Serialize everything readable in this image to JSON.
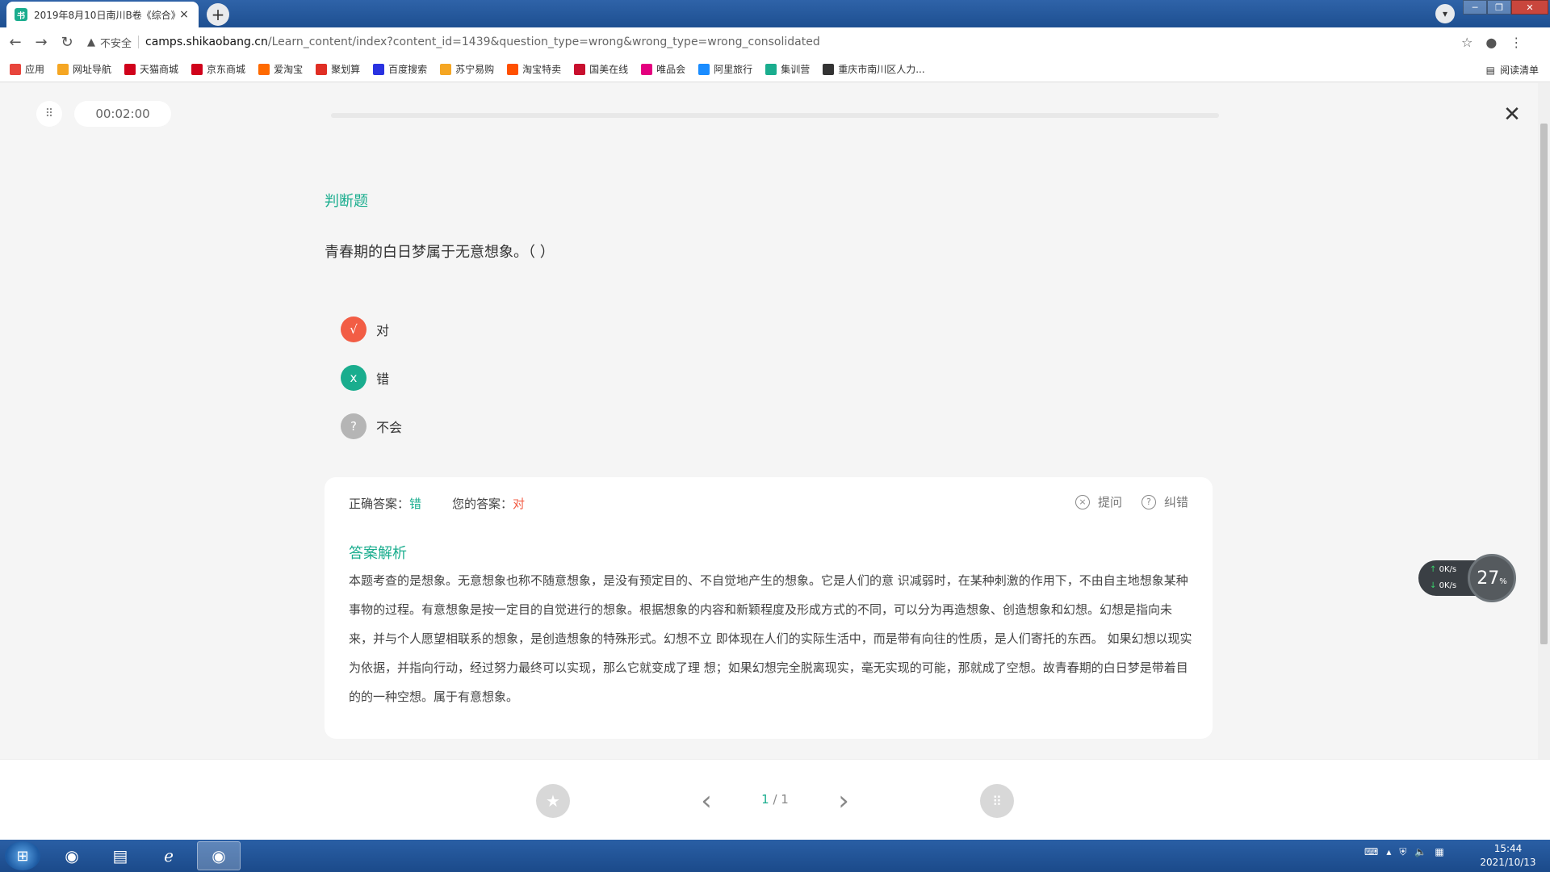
{
  "browser": {
    "tab_title": "2019年8月10日南川B卷《综合》",
    "tab_close": "×",
    "new_tab": "+",
    "insecure_label": "不安全",
    "url_host": "camps.shikaobang.cn",
    "url_path": "/Learn_content/index?content_id=1439&question_type=wrong&wrong_type=wrong_consolidated",
    "bookmarks": [
      {
        "label": "应用",
        "color": "#e8453c"
      },
      {
        "label": "网址导航",
        "color": "#f5a623"
      },
      {
        "label": "天猫商城",
        "color": "#d0021b"
      },
      {
        "label": "京东商城",
        "color": "#d0021b"
      },
      {
        "label": "爱淘宝",
        "color": "#ff6a00"
      },
      {
        "label": "聚划算",
        "color": "#e02e24"
      },
      {
        "label": "百度搜索",
        "color": "#2932e1"
      },
      {
        "label": "苏宁易购",
        "color": "#f5a623"
      },
      {
        "label": "淘宝特卖",
        "color": "#ff5000"
      },
      {
        "label": "国美在线",
        "color": "#c8102e"
      },
      {
        "label": "唯品会",
        "color": "#e4007f"
      },
      {
        "label": "阿里旅行",
        "color": "#1a8cff"
      },
      {
        "label": "集训营",
        "color": "#1aad8e"
      },
      {
        "label": "重庆市南川区人力...",
        "color": "#333333"
      }
    ],
    "reading_list": "阅读清单"
  },
  "quiz": {
    "timer": "00:02:00",
    "progress_fraction": 0.0,
    "question_type": "判断题",
    "question_text": "青春期的白日梦属于无意想象。（ ）",
    "options": [
      {
        "badge": "√",
        "label": "对",
        "color": "#f25d45"
      },
      {
        "badge": "x",
        "label": "错",
        "color": "#1aad8e"
      },
      {
        "badge": "?",
        "label": "不会",
        "color": "#b5b5b5"
      }
    ],
    "answer": {
      "correct_label": "正确答案：",
      "correct_value": "错",
      "yours_label": "您的答案：",
      "yours_value": "对",
      "ask_label": "提问",
      "report_label": "纠错"
    },
    "analysis_title": "答案解析",
    "analysis_text": "本题考查的是想象。无意想象也称不随意想象，是没有预定目的、不自觉地产生的想象。它是人们的意 识减弱时，在某种刺激的作用下，不由自主地想象某种事物的过程。有意想象是按一定目的自觉进行的想象。根据想象的内容和新颖程度及形成方式的不同，可以分为再造想象、创造想象和幻想。幻想是指向未来，并与个人愿望相联系的想象，是创造想象的特殊形式。幻想不立 即体现在人们的实际生活中，而是带有向往的性质，是人们寄托的东西。 如果幻想以现实为依据，并指向行动，经过努力最终可以实现，那么它就变成了理 想；如果幻想完全脱离现实，毫无实现的可能，那就成了空想。故青春期的白日梦是带着目的的一种空想。属于有意想象。",
    "pager_current": "1",
    "pager_sep": " / ",
    "pager_total": "1"
  },
  "widget": {
    "up_speed": "0",
    "down_speed": "0",
    "unit": "K/s",
    "percent": "27",
    "percent_sign": "%"
  },
  "taskbar": {
    "time": "15:44",
    "date": "2021/10/13"
  }
}
